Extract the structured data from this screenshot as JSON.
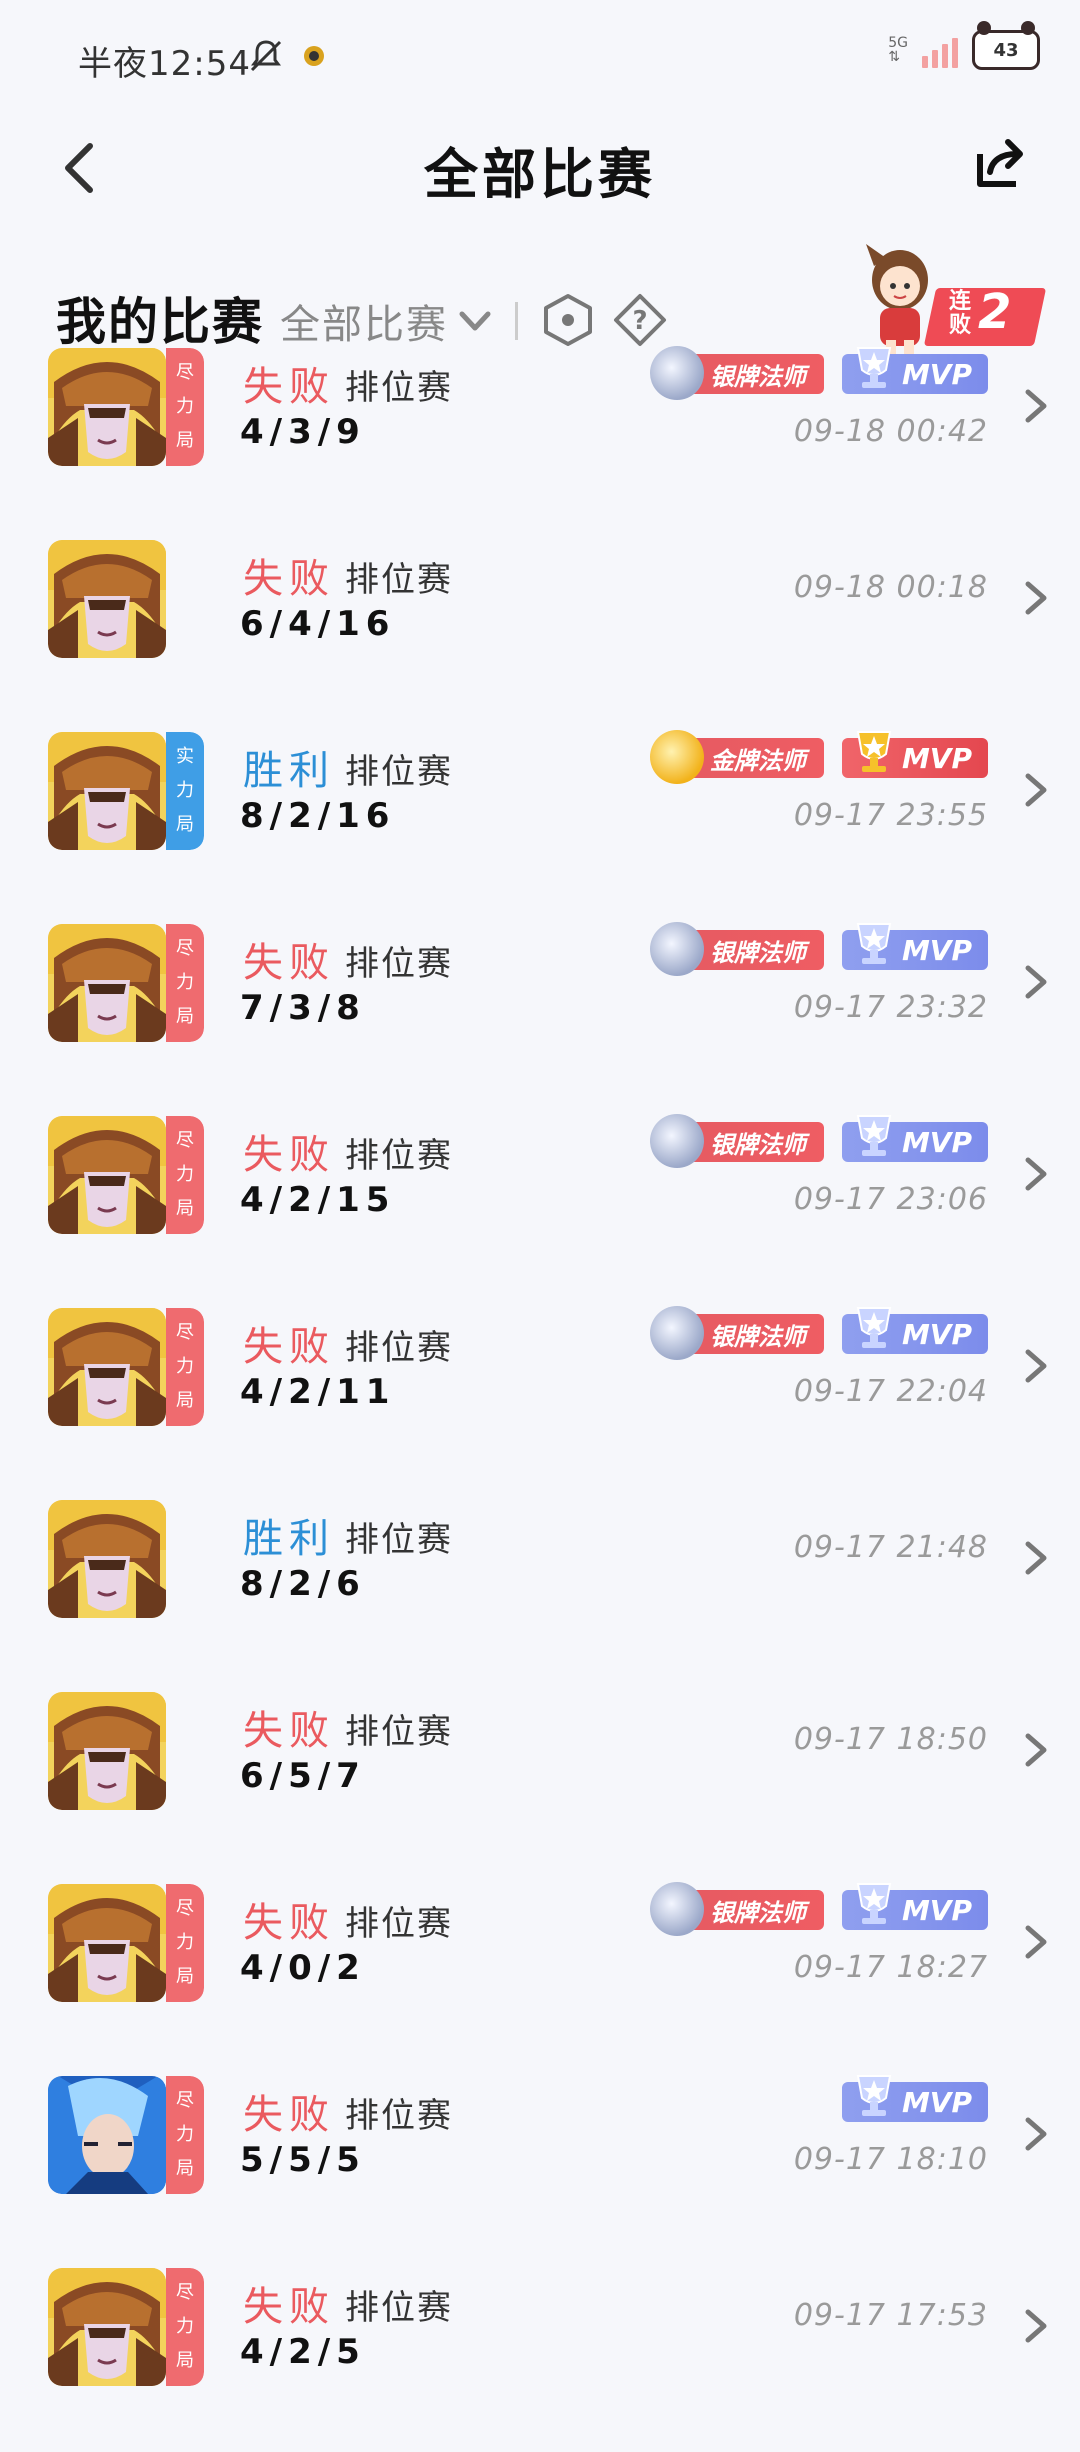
{
  "status_bar": {
    "time": "半夜12:54",
    "network": "5G",
    "battery": "43"
  },
  "header": {
    "title": "全部比赛"
  },
  "filter": {
    "my_games_label": "我的比赛",
    "dropdown_value": "全部比赛"
  },
  "streak": {
    "label": "连败",
    "count": "2"
  },
  "matches": [
    {
      "result": "失败",
      "outcome": "lose",
      "mode": "排位赛",
      "kda": "4/3/9",
      "time": "09-18 00:42",
      "tag": "尽力局",
      "tag_color": "red",
      "medal": "银牌法师",
      "medal_type": "silver",
      "mvp": "MVP",
      "mvp_type": "blue",
      "hero": "gold"
    },
    {
      "result": "失败",
      "outcome": "lose",
      "mode": "排位赛",
      "kda": "6/4/16",
      "time": "09-18 00:18",
      "tag": "",
      "tag_color": "",
      "medal": "",
      "medal_type": "",
      "mvp": "",
      "mvp_type": "",
      "hero": "gold"
    },
    {
      "result": "胜利",
      "outcome": "win",
      "mode": "排位赛",
      "kda": "8/2/16",
      "time": "09-17 23:55",
      "tag": "实力局",
      "tag_color": "blue",
      "medal": "金牌法师",
      "medal_type": "gold",
      "mvp": "MVP",
      "mvp_type": "gold",
      "hero": "gold"
    },
    {
      "result": "失败",
      "outcome": "lose",
      "mode": "排位赛",
      "kda": "7/3/8",
      "time": "09-17 23:32",
      "tag": "尽力局",
      "tag_color": "red",
      "medal": "银牌法师",
      "medal_type": "silver",
      "mvp": "MVP",
      "mvp_type": "blue",
      "hero": "gold"
    },
    {
      "result": "失败",
      "outcome": "lose",
      "mode": "排位赛",
      "kda": "4/2/15",
      "time": "09-17 23:06",
      "tag": "尽力局",
      "tag_color": "red",
      "medal": "银牌法师",
      "medal_type": "silver",
      "mvp": "MVP",
      "mvp_type": "blue",
      "hero": "gold"
    },
    {
      "result": "失败",
      "outcome": "lose",
      "mode": "排位赛",
      "kda": "4/2/11",
      "time": "09-17 22:04",
      "tag": "尽力局",
      "tag_color": "red",
      "medal": "银牌法师",
      "medal_type": "silver",
      "mvp": "MVP",
      "mvp_type": "blue",
      "hero": "gold"
    },
    {
      "result": "胜利",
      "outcome": "win",
      "mode": "排位赛",
      "kda": "8/2/6",
      "time": "09-17 21:48",
      "tag": "",
      "tag_color": "",
      "medal": "",
      "medal_type": "",
      "mvp": "",
      "mvp_type": "",
      "hero": "gold"
    },
    {
      "result": "失败",
      "outcome": "lose",
      "mode": "排位赛",
      "kda": "6/5/7",
      "time": "09-17 18:50",
      "tag": "",
      "tag_color": "",
      "medal": "",
      "medal_type": "",
      "mvp": "",
      "mvp_type": "",
      "hero": "gold"
    },
    {
      "result": "失败",
      "outcome": "lose",
      "mode": "排位赛",
      "kda": "4/0/2",
      "time": "09-17 18:27",
      "tag": "尽力局",
      "tag_color": "red",
      "medal": "银牌法师",
      "medal_type": "silver",
      "mvp": "MVP",
      "mvp_type": "blue",
      "hero": "gold"
    },
    {
      "result": "失败",
      "outcome": "lose",
      "mode": "排位赛",
      "kda": "5/5/5",
      "time": "09-17 18:10",
      "tag": "尽力局",
      "tag_color": "red",
      "medal": "",
      "medal_type": "",
      "mvp": "MVP",
      "mvp_type": "blue",
      "hero": "blue"
    },
    {
      "result": "失败",
      "outcome": "lose",
      "mode": "排位赛",
      "kda": "4/2/5",
      "time": "09-17 17:53",
      "tag": "尽力局",
      "tag_color": "red",
      "medal": "",
      "medal_type": "",
      "mvp": "",
      "mvp_type": "",
      "hero": "gold"
    }
  ],
  "colors": {
    "lose": "#ea5a5f",
    "win": "#2c8fd6",
    "background": "#f6f7fb"
  }
}
